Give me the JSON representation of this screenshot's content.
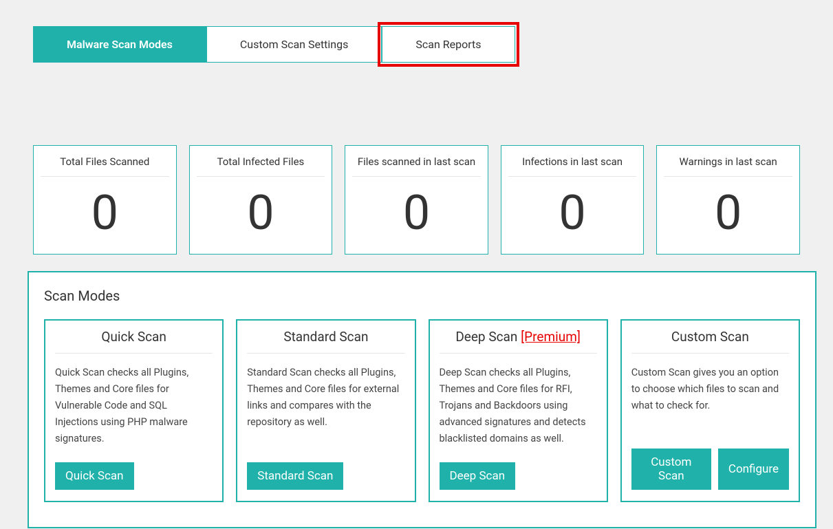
{
  "tabs": [
    {
      "label": "Malware Scan Modes",
      "active": true,
      "highlight": false
    },
    {
      "label": "Custom Scan Settings",
      "active": false,
      "highlight": false
    },
    {
      "label": "Scan Reports",
      "active": false,
      "highlight": true
    }
  ],
  "stats": [
    {
      "title": "Total Files Scanned",
      "value": "0"
    },
    {
      "title": "Total Infected Files",
      "value": "0"
    },
    {
      "title": "Files scanned in last scan",
      "value": "0"
    },
    {
      "title": "Infections in last scan",
      "value": "0"
    },
    {
      "title": "Warnings in last scan",
      "value": "0"
    }
  ],
  "scanModes": {
    "title": "Scan Modes",
    "modes": [
      {
        "name": "Quick Scan",
        "premium": "",
        "desc": "Quick Scan checks all Plugins, Themes and Core files for Vulnerable Code and SQL Injections using PHP malware signatures.",
        "buttons": [
          "Quick Scan"
        ]
      },
      {
        "name": "Standard Scan",
        "premium": "",
        "desc": "Standard Scan checks all Plugins, Themes and Core files for external links and compares with the repository as well.",
        "buttons": [
          "Standard Scan"
        ]
      },
      {
        "name": "Deep Scan",
        "premium": "[Premium]",
        "desc": "Deep Scan checks all Plugins, Themes and Core files for RFI, Trojans and Backdoors using advanced signatures and detects blacklisted domains as well.",
        "buttons": [
          "Deep Scan"
        ]
      },
      {
        "name": "Custom Scan",
        "premium": "",
        "desc": "Custom Scan gives you an option to choose which files to scan and what to check for.",
        "buttons": [
          "Custom Scan",
          "Configure"
        ]
      }
    ]
  }
}
